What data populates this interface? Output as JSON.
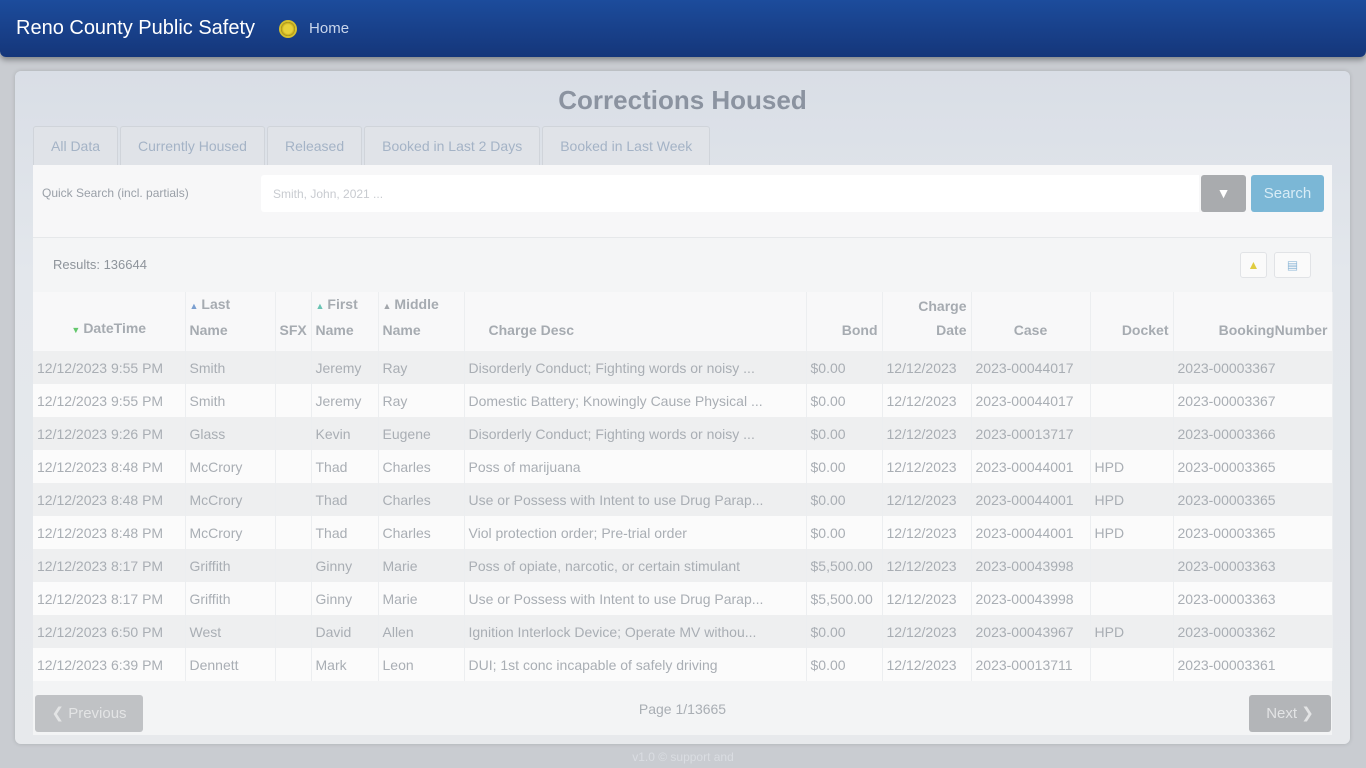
{
  "nav": {
    "brand": "Reno County Public Safety",
    "home_label": "Home"
  },
  "page_title": "Corrections Housed",
  "tabs": [
    {
      "label": "All Data"
    },
    {
      "label": "Currently Housed"
    },
    {
      "label": "Released"
    },
    {
      "label": "Booked in Last 2 Days"
    },
    {
      "label": "Booked in Last Week"
    }
  ],
  "search": {
    "label": "Quick Search (incl. partials)",
    "placeholder": "Smith, John, 2021 ...",
    "button_label": "Search",
    "filter_icon": "filter-icon"
  },
  "results_label": "Results: 136644",
  "table": {
    "columns": [
      "DateTime",
      "Last Name",
      "SFX",
      "First Name",
      "Middle Name",
      "Charge Desc",
      "Bond",
      "Charge Date",
      "Case",
      "Docket",
      "BookingNumber"
    ],
    "header": {
      "datetime": "DateTime",
      "last_1": "Last",
      "last_2": "Name",
      "sfx": "SFX",
      "first_1": "First",
      "first_2": "Name",
      "middle_1": "Middle",
      "middle_2": "Name",
      "charge": "Charge Desc",
      "bond": "Bond",
      "cdate_1": "Charge",
      "cdate_2": "Date",
      "case": "Case",
      "docket": "Docket",
      "booking": "BookingNumber"
    },
    "rows": [
      [
        "12/12/2023 9:55 PM",
        "Smith",
        "",
        "Jeremy",
        "Ray",
        "Disorderly Conduct; Fighting words or noisy ...",
        "$0.00",
        "12/12/2023",
        "2023-00044017",
        "",
        "2023-00003367"
      ],
      [
        "12/12/2023 9:55 PM",
        "Smith",
        "",
        "Jeremy",
        "Ray",
        "Domestic Battery; Knowingly Cause Physical ...",
        "$0.00",
        "12/12/2023",
        "2023-00044017",
        "",
        "2023-00003367"
      ],
      [
        "12/12/2023 9:26 PM",
        "Glass",
        "",
        "Kevin",
        "Eugene",
        "Disorderly Conduct; Fighting words or noisy ...",
        "$0.00",
        "12/12/2023",
        "2023-00013717",
        "",
        "2023-00003366"
      ],
      [
        "12/12/2023 8:48 PM",
        "McCrory",
        "",
        "Thad",
        "Charles",
        "Poss of marijuana",
        "$0.00",
        "12/12/2023",
        "2023-00044001",
        "HPD",
        "2023-00003365"
      ],
      [
        "12/12/2023 8:48 PM",
        "McCrory",
        "",
        "Thad",
        "Charles",
        "Use or Possess with Intent to use Drug Parap...",
        "$0.00",
        "12/12/2023",
        "2023-00044001",
        "HPD",
        "2023-00003365"
      ],
      [
        "12/12/2023 8:48 PM",
        "McCrory",
        "",
        "Thad",
        "Charles",
        "Viol protection order; Pre-trial order",
        "$0.00",
        "12/12/2023",
        "2023-00044001",
        "HPD",
        "2023-00003365"
      ],
      [
        "12/12/2023 8:17 PM",
        "Griffith",
        "",
        "Ginny",
        "Marie",
        "Poss of opiate, narcotic, or certain stimulant",
        "$5,500.00",
        "12/12/2023",
        "2023-00043998",
        "",
        "2023-00003363"
      ],
      [
        "12/12/2023 8:17 PM",
        "Griffith",
        "",
        "Ginny",
        "Marie",
        "Use or Possess with Intent to use Drug Parap...",
        "$5,500.00",
        "12/12/2023",
        "2023-00043998",
        "",
        "2023-00003363"
      ],
      [
        "12/12/2023 6:50 PM",
        "West",
        "",
        "David",
        "Allen",
        "Ignition Interlock Device; Operate MV withou...",
        "$0.00",
        "12/12/2023",
        "2023-00043967",
        "HPD",
        "2023-00003362"
      ],
      [
        "12/12/2023 6:39 PM",
        "Dennett",
        "",
        "Mark",
        "Leon",
        "DUI; 1st conc incapable of safely driving",
        "$0.00",
        "12/12/2023",
        "2023-00013711",
        "",
        "2023-00003361"
      ]
    ]
  },
  "pager": {
    "prev_label": "Previous",
    "next_label": "Next",
    "page_info": "Page 1/13665"
  },
  "footer": "v1.0 © support and"
}
